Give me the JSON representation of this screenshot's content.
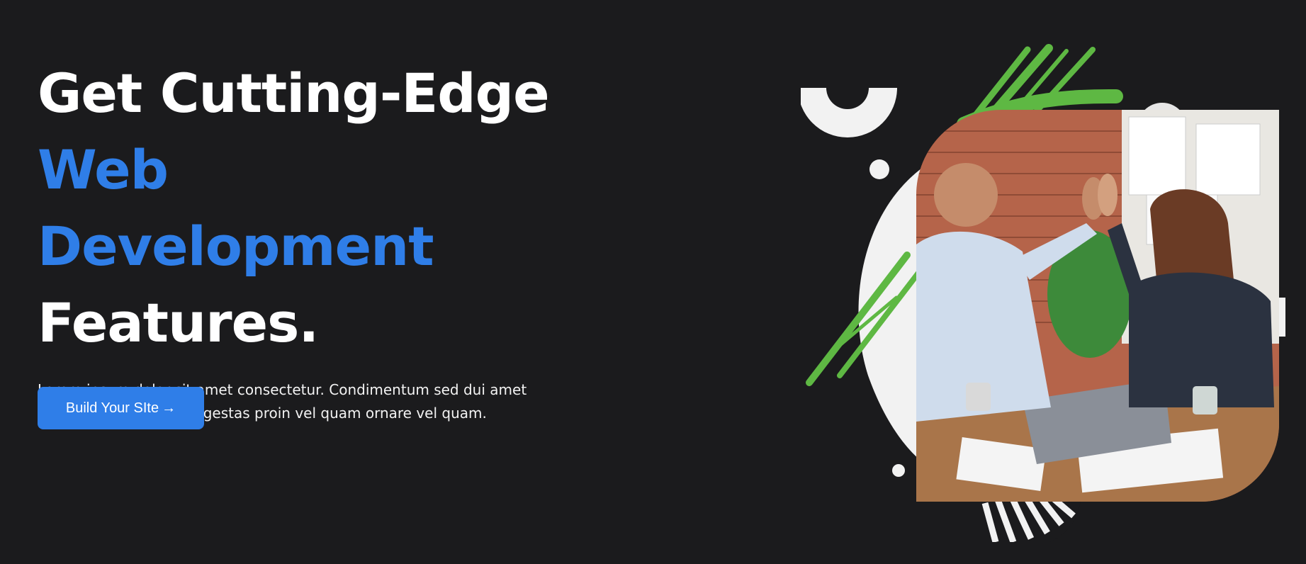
{
  "hero": {
    "headline_line1": "Get Cutting-Edge",
    "headline_line2": "Web Development",
    "headline_line3": "Features.",
    "description": "Lorem ipsum dolor sit amet consectetur. Condimentum sed dui amet sollicitudin nullam et. Egestas proin vel quam ornare vel quam.",
    "cta_label": "Build Your SIte",
    "cta_icon": "arrow-right-icon"
  },
  "colors": {
    "background": "#1b1b1d",
    "accent": "#2f7ee8",
    "decor_green": "#5eb843",
    "decor_white": "#f2f2f2"
  }
}
